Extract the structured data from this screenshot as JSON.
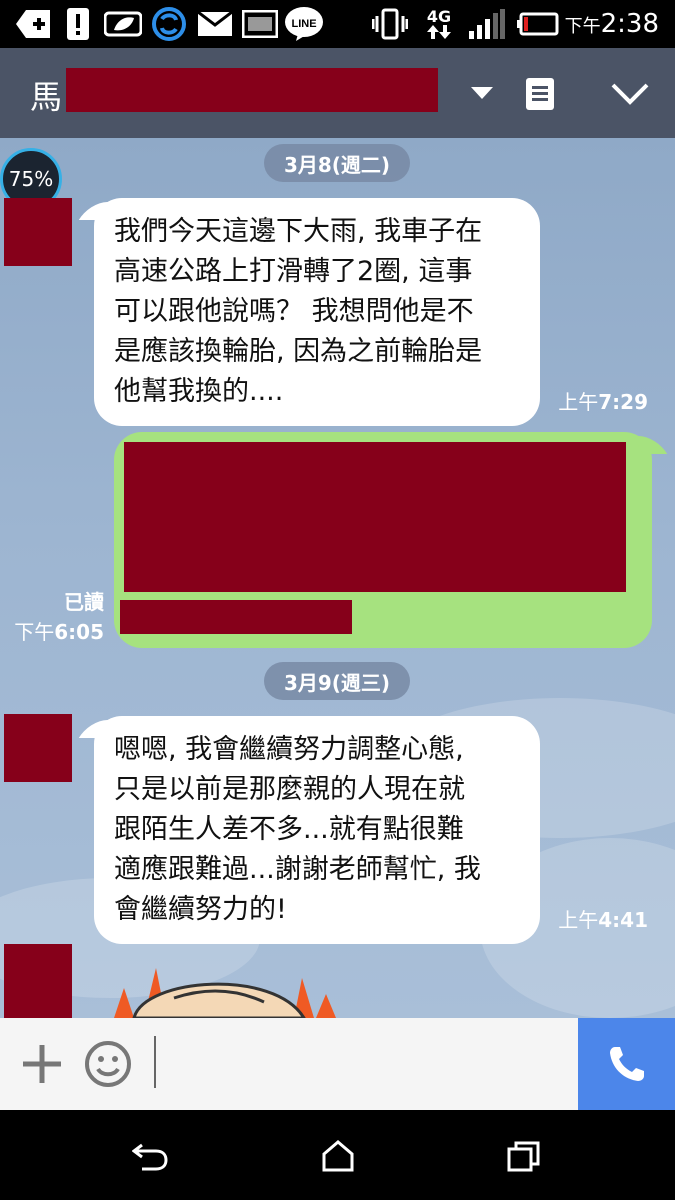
{
  "status_bar": {
    "time": "2:38",
    "time_ampm": "下午",
    "network": "4G"
  },
  "header": {
    "chat_title": "馬"
  },
  "chat": {
    "battery_badge": "75%",
    "dates": [
      {
        "label": "3月8(週二)"
      },
      {
        "label": "3月9(週三)"
      }
    ],
    "messages": [
      {
        "lines": [
          "我們今天這邊下大雨, 我車子在",
          "高速公路上打滑轉了2圈, 這事",
          "可以跟他說嗎？ 我想問他是不",
          "是應該換輪胎, 因為之前輪胎是",
          "他幫我換的...."
        ],
        "ampm": "上午",
        "time": "7:29"
      },
      {
        "read_status": "已讀",
        "ampm": "下午",
        "time": "6:05"
      },
      {
        "lines": [
          "嗯嗯, 我會繼續努力調整心態,",
          "只是以前是那麼親的人現在就",
          "跟陌生人差不多...就有點很難",
          "適應跟難過...謝謝老師幫忙, 我",
          "會繼續努力的!"
        ],
        "ampm": "上午",
        "time": "4:41"
      }
    ]
  },
  "input_bar": {
    "placeholder": ""
  },
  "colors": {
    "header_bg": "#4b5466",
    "outgoing_bubble": "#a6e27f",
    "call_button": "#4c86ea",
    "redaction": "#86001a"
  },
  "icons": [
    "add-icon",
    "warning-icon",
    "leaf-icon",
    "sync-icon",
    "mail-icon",
    "image-icon",
    "line-icon",
    "vibrate-icon",
    "signal-icon",
    "battery-icon",
    "dropdown-icon",
    "notes-icon",
    "collapse-icon",
    "plus-icon",
    "emoji-icon",
    "phone-icon",
    "back-icon",
    "home-icon",
    "recents-icon"
  ]
}
